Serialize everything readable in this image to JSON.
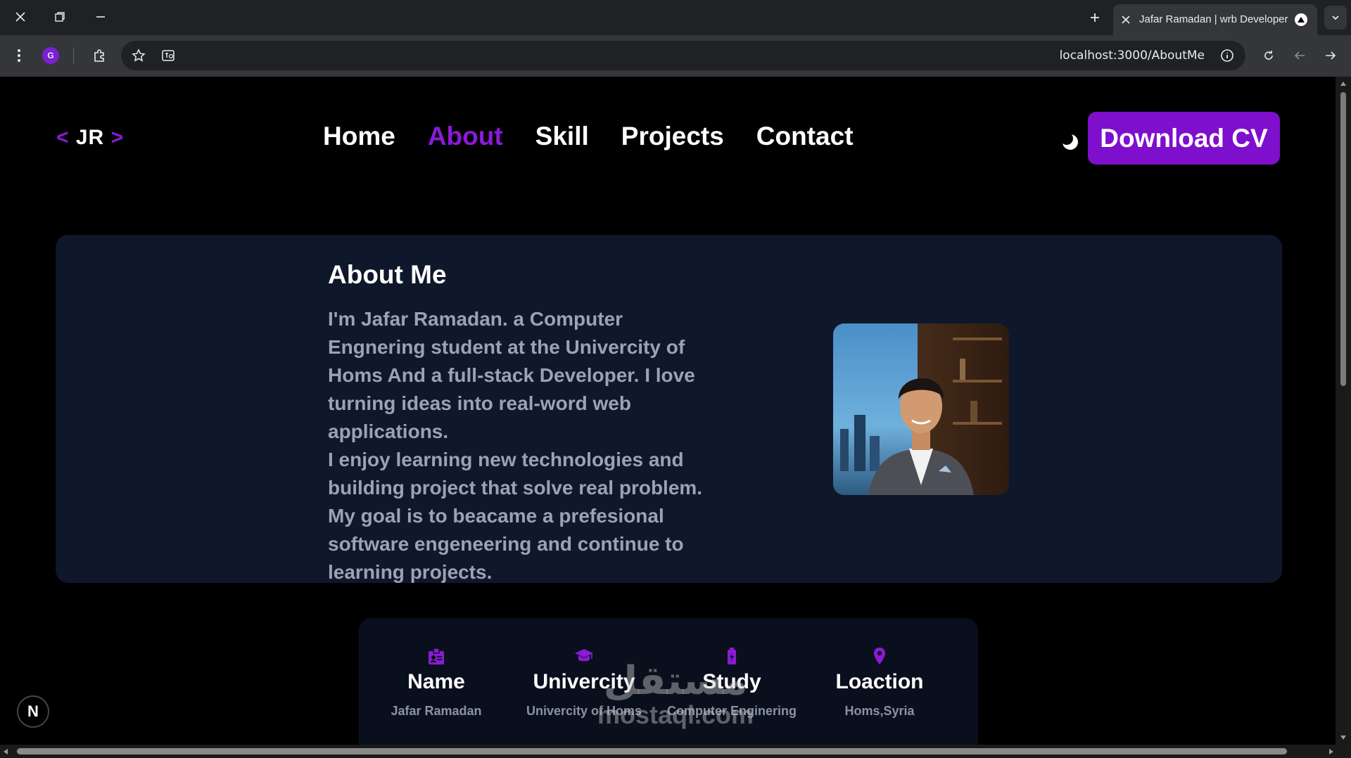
{
  "browser": {
    "tab_title": "Jafar Ramadan | wrb Developer",
    "url": "localhost:3000/AboutMe",
    "profile_initial": "G"
  },
  "site": {
    "logo": {
      "open": "<",
      "text": "JR",
      "close": ">"
    },
    "nav": [
      {
        "label": "Home",
        "active": false
      },
      {
        "label": "About",
        "active": true
      },
      {
        "label": "Skill",
        "active": false
      },
      {
        "label": "Projects",
        "active": false
      },
      {
        "label": "Contact",
        "active": false
      }
    ],
    "cv_button": "Download CV"
  },
  "about": {
    "title": "About Me",
    "para1": "I'm Jafar Ramadan. a Computer Engnering student at the Univercity of Homs And a full-stack Developer. I love turning ideas into real-word web applications.",
    "para2": "I enjoy learning new technologies and building project that solve real problem. My goal is to beacame a prefesional software engeneering and continue to learning projects."
  },
  "stats": [
    {
      "icon": "id-badge-icon",
      "label": "Name",
      "value": "Jafar Ramadan"
    },
    {
      "icon": "graduation-cap-icon",
      "label": "Univercity",
      "value": "Univercity of Homs"
    },
    {
      "icon": "battery-icon",
      "label": "Study",
      "value": "Computer Enginering"
    },
    {
      "icon": "location-pin-icon",
      "label": "Loaction",
      "value": "Homs,Syria"
    }
  ],
  "watermark": {
    "arabic": "مستقل",
    "latin": "mostaql.com"
  },
  "dev_badge": "N",
  "colors": {
    "accent": "#7e0fcd",
    "card": "#0f172a",
    "page": "#000000"
  }
}
